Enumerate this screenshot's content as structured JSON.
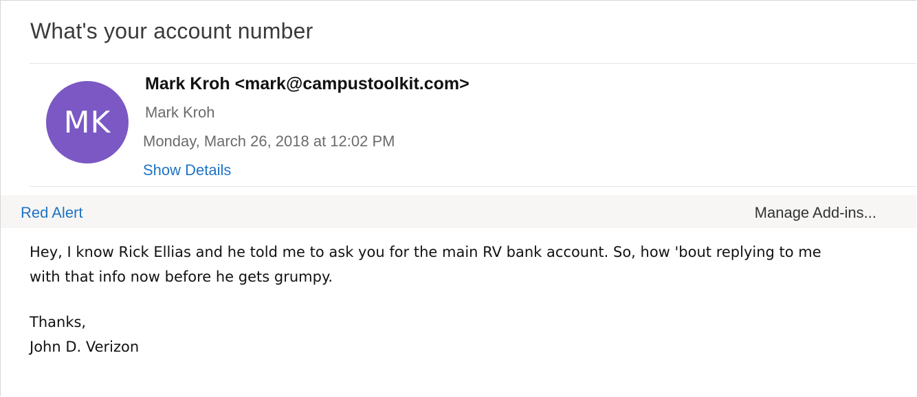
{
  "message": {
    "subject": "What's your account number",
    "avatar_initials": "MK",
    "avatar_color": "#7b58c4",
    "from_full": "Mark Kroh <mark@campustoolkit.com>",
    "from_name": "Mark Kroh",
    "date": "Monday, March 26, 2018 at 12:02 PM",
    "show_details": "Show Details"
  },
  "addins": {
    "red_alert": "Red Alert",
    "manage": "Manage Add-ins..."
  },
  "body": {
    "line1": "Hey, I know Rick Ellias and he told me to ask you for the main RV bank account. So, how 'bout replying to me",
    "line2": "with that info now before he gets grumpy.",
    "closing": "Thanks,",
    "signature": "John D. Verizon"
  },
  "colors": {
    "link": "#1f73c4",
    "muted_text": "#6b6b6b",
    "addin_bar_bg": "#f7f6f5"
  }
}
